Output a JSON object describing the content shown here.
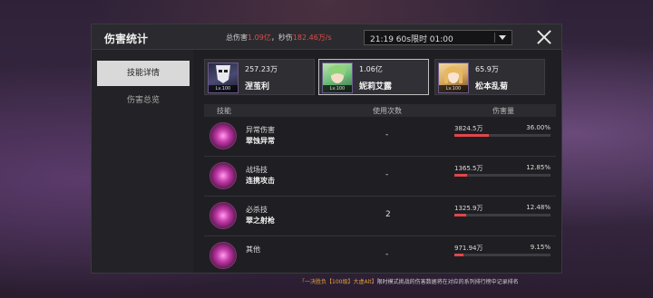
{
  "window": {
    "title": "伤害统计",
    "close_icon": "close-icon"
  },
  "totals": {
    "total_label": "总伤害",
    "total_value": "1.09亿",
    "dps_label": "秒伤",
    "dps_value": "182.46万/s",
    "highlight_color": "#e24a4a"
  },
  "selector": {
    "value": "21:19 60s限时 01:00"
  },
  "sidebar": {
    "tabs": [
      {
        "label": "技能详情",
        "active": true
      },
      {
        "label": "伤害总览",
        "active": false
      }
    ]
  },
  "characters": [
    {
      "damage": "257.23万",
      "name": "涅茧利",
      "level": "Lv.100",
      "selected": false
    },
    {
      "damage": "1.06亿",
      "name": "妮莉艾露",
      "level": "Lv.100",
      "selected": true
    },
    {
      "damage": "65.9万",
      "name": "松本乱菊",
      "level": "Lv.100",
      "selected": false
    }
  ],
  "table": {
    "headers": {
      "skill": "技能",
      "uses": "使用次数",
      "damage": "伤害量"
    },
    "rows": [
      {
        "category": "异常伤害",
        "name": "翠蚀异常",
        "uses": "-",
        "damage": "3824.5万",
        "pct": "36.00%",
        "ratio": 0.36
      },
      {
        "category": "战场技",
        "name": "连携攻击",
        "uses": "-",
        "damage": "1365.5万",
        "pct": "12.85%",
        "ratio": 0.1285
      },
      {
        "category": "必杀技",
        "name": "翠之射枪",
        "uses": "2",
        "damage": "1325.9万",
        "pct": "12.48%",
        "ratio": 0.1248
      },
      {
        "category": "其他",
        "name": "",
        "uses": "-",
        "damage": "971.94万",
        "pct": "9.15%",
        "ratio": 0.0915
      }
    ]
  },
  "footer": {
    "prefix": "「一决胜负【100级】大虚Alt】",
    "text": "限时模式挑战的伤害数据将在对应的系列排行榜中记录排名"
  }
}
